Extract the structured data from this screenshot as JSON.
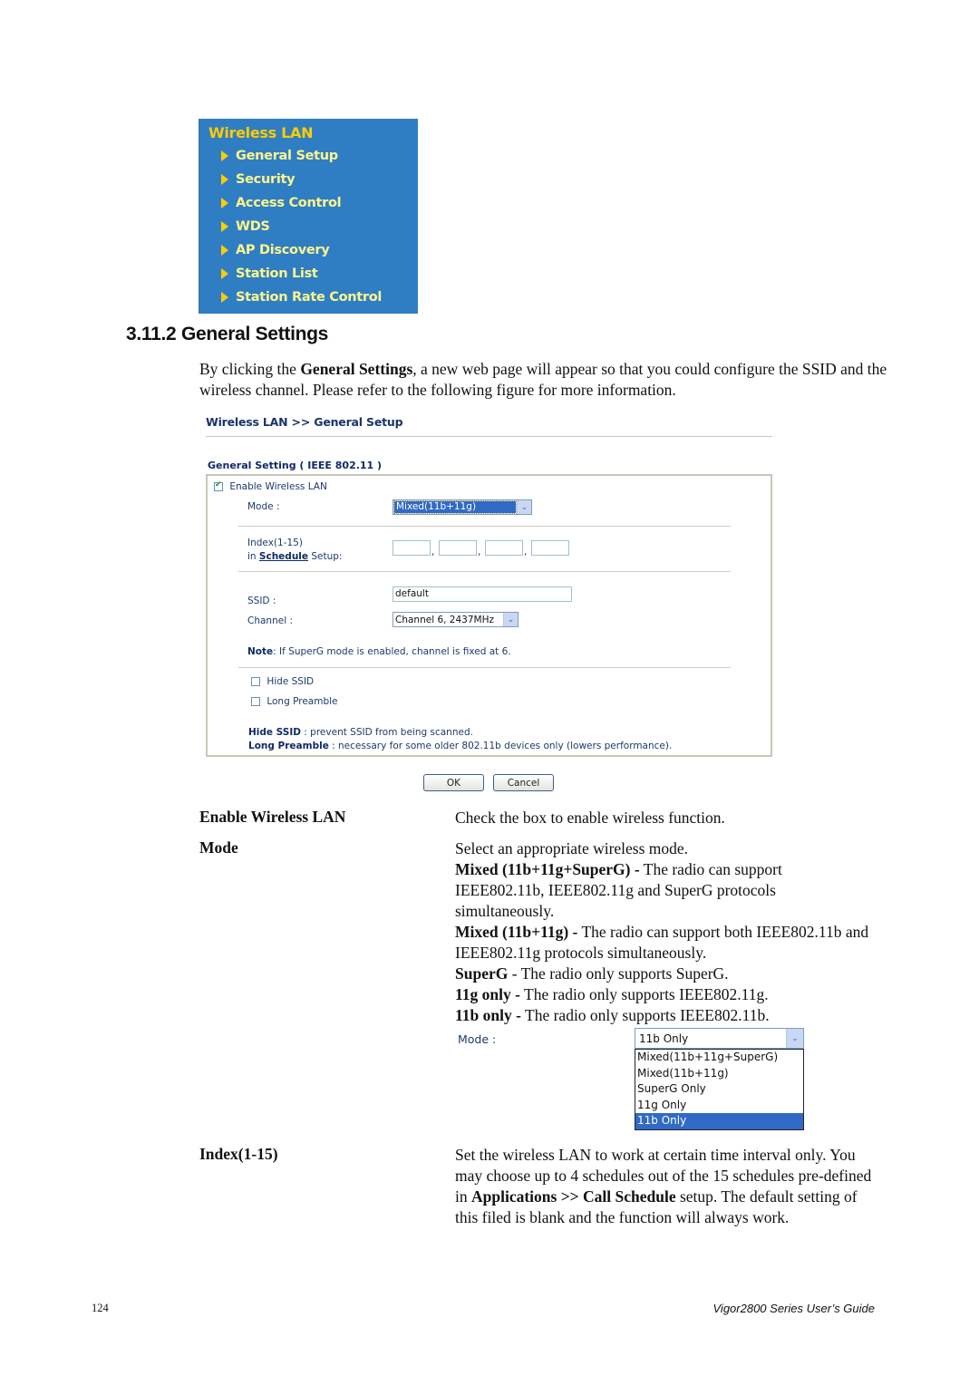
{
  "menu": {
    "title": "Wireless LAN",
    "items": [
      {
        "label": "General Setup"
      },
      {
        "label": "Security"
      },
      {
        "label": "Access Control"
      },
      {
        "label": "WDS"
      },
      {
        "label": "AP Discovery"
      },
      {
        "label": "Station List"
      },
      {
        "label": "Station Rate Control"
      }
    ]
  },
  "section": {
    "heading": "3.11.2 General Settings",
    "intro_pre": "By clicking the ",
    "intro_bold": "General Settings",
    "intro_post": ", a new web page will appear so that you could configure the SSID and the wireless channel. Please refer to the following figure for more information."
  },
  "form": {
    "breadcrumb": "Wireless LAN >> General Setup",
    "section_title": "General Setting ( IEEE 802.11 )",
    "enable_label": "Enable Wireless LAN",
    "enable_checked": true,
    "mode_label": "Mode :",
    "mode_value": "Mixed(11b+11g)",
    "index_label_1": "Index(1-15)",
    "index_label_in": "in ",
    "index_label_link": "Schedule",
    "index_label_setup": " Setup:",
    "index_values": [
      "",
      "",
      "",
      ""
    ],
    "index_sep": ",",
    "ssid_label": "SSID :",
    "ssid_value": "default",
    "channel_label": "Channel :",
    "channel_value": "Channel 6, 2437MHz",
    "note_bold": "Note",
    "note_text": ": If SuperG mode is enabled, channel is fixed at 6.",
    "hide_ssid_label": "Hide SSID",
    "hide_ssid_checked": false,
    "long_preamble_label": "Long Preamble",
    "long_preamble_checked": false,
    "help_hide_bold": "Hide SSID",
    "help_hide_text": " : prevent SSID from being scanned.",
    "help_long_bold": "Long Preamble",
    "help_long_text": " : necessary for some older 802.11b devices only (lowers performance).",
    "ok_label": "OK",
    "cancel_label": "Cancel"
  },
  "definitions": {
    "enable": {
      "term": "Enable Wireless LAN",
      "text": "Check the box to enable wireless function."
    },
    "mode": {
      "term": "Mode",
      "intro": "Select an appropriate wireless mode.",
      "entries": [
        {
          "bold": "Mixed (11b+11g+SuperG) -",
          "text": " The radio can support IEEE802.11b, IEEE802.11g and SuperG protocols simultaneously."
        },
        {
          "bold": "Mixed (11b+11g) -",
          "text": " The radio can support both IEEE802.11b and IEEE802.11g protocols simultaneously."
        },
        {
          "bold": "SuperG",
          "text": " - The radio only supports SuperG."
        },
        {
          "bold": "11g only -",
          "text": " The radio only supports IEEE802.11g."
        },
        {
          "bold": "11b only -",
          "text": " The radio only supports IEEE802.11b."
        }
      ]
    },
    "mode_dropdown": {
      "label": "Mode :",
      "selected": "11b Only",
      "options": [
        "Mixed(11b+11g+SuperG)",
        "Mixed(11b+11g)",
        "SuperG Only",
        "11g Only",
        "11b Only"
      ],
      "highlighted_index": 4
    },
    "index": {
      "term": "Index(1-15)",
      "text_pre": "Set the wireless LAN to work at certain time interval only. You may choose up to 4 schedules out of the 15 schedules pre-defined in ",
      "text_bold": "Applications >> Call Schedule",
      "text_post": " setup. The default setting of this filed is blank and the function will always work."
    }
  },
  "footer": {
    "page_number": "124",
    "guide_title": "Vigor2800  Series  User’s  Guide"
  }
}
